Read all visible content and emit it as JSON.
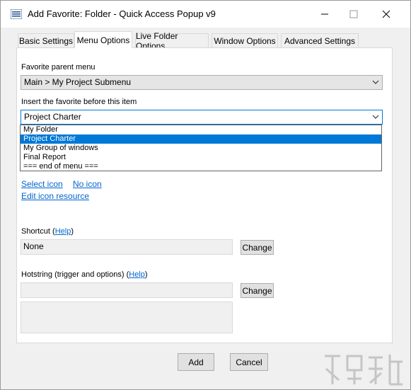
{
  "window": {
    "title": "Add Favorite: Folder - Quick Access Popup v9",
    "controls": {
      "minimize_icon": "minimize-icon",
      "maximize_icon": "maximize-icon",
      "close_icon": "close-icon"
    }
  },
  "tabs": [
    {
      "label": "Basic Settings"
    },
    {
      "label": "Menu Options"
    },
    {
      "label": "Live Folder Options"
    },
    {
      "label": "Window Options"
    },
    {
      "label": "Advanced Settings"
    }
  ],
  "active_tab": "Menu Options",
  "menu_options": {
    "parent_menu_label": "Favorite parent menu",
    "parent_menu_value": "Main > My Project Submenu",
    "insert_before_label": "Insert the favorite before this item",
    "insert_before_value": "Project Charter",
    "insert_before_options": [
      "My Folder",
      "Project Charter",
      "My Group of windows",
      "Final Report",
      "=== end of menu ==="
    ],
    "selected_option": "Project Charter",
    "select_icon_link": "Select icon",
    "no_icon_link": "No icon",
    "edit_icon_link": "Edit icon resource",
    "shortcut_label": "Shortcut",
    "shortcut_help_open": "(",
    "shortcut_help_link": "Help",
    "shortcut_help_close": ")",
    "shortcut_value": "None",
    "shortcut_change": "Change",
    "hotstring_label": "Hotstring (trigger and options)",
    "hotstring_help_open": "(",
    "hotstring_help_link": "Help",
    "hotstring_help_close": ")",
    "hotstring_value": "",
    "hotstring_change": "Change",
    "hotstring_details": ""
  },
  "footer": {
    "add_label": "Add",
    "cancel_label": "Cancel"
  },
  "colors": {
    "accent": "#0078d7",
    "link": "#0066cc",
    "window_bg": "#f0f0f0",
    "panel_bg": "#ffffff"
  }
}
